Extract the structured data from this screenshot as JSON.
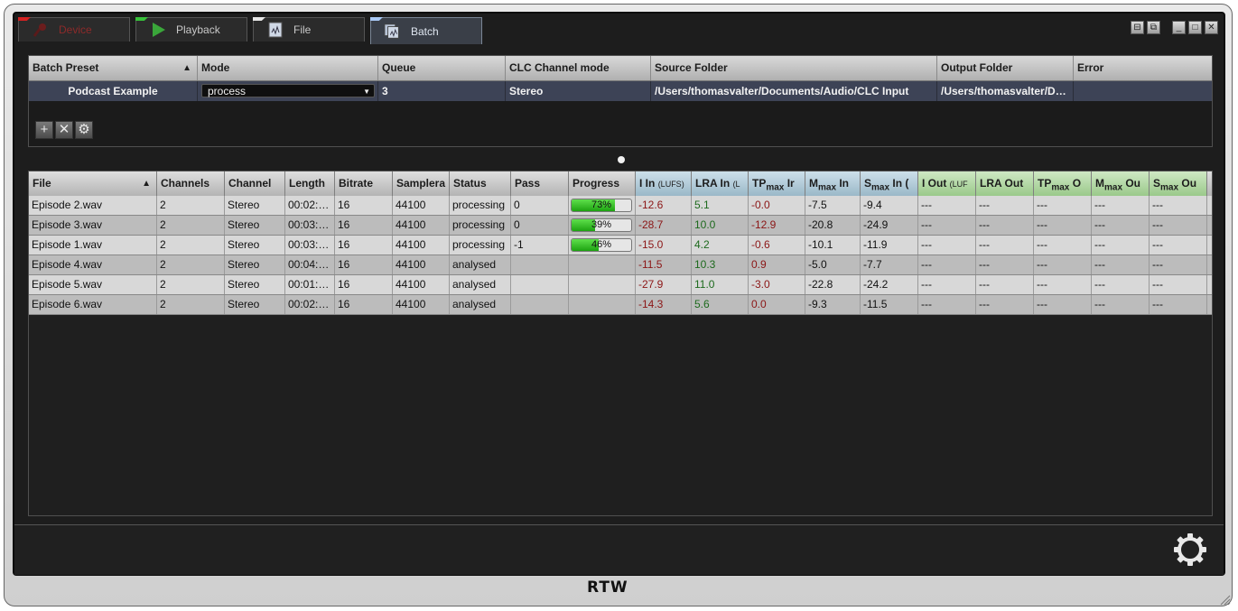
{
  "tabs": [
    {
      "label": "Device",
      "notch": "#d42222"
    },
    {
      "label": "Playback",
      "notch": "#37c23a"
    },
    {
      "label": "File",
      "notch": "#e6e6e6"
    },
    {
      "label": "Batch",
      "notch": "#a9c9f5"
    }
  ],
  "presets": {
    "headers": [
      "Batch Preset",
      "Mode",
      "Queue",
      "CLC Channel mode",
      "Source Folder",
      "Output Folder",
      "Error"
    ],
    "row": {
      "preset": "Podcast Example",
      "mode": "process",
      "queue": "3",
      "clc_mode": "Stereo",
      "source": "/Users/thomasvalter/Documents/Audio/CLC Input",
      "output": "/Users/thomasvalter/D…",
      "error": ""
    }
  },
  "tools": {
    "add": "+",
    "remove": "✕",
    "settings": "⚙"
  },
  "files": {
    "headers": {
      "file": "File",
      "channels": "Channels",
      "channel": "Channel",
      "length": "Length",
      "bitrate": "Bitrate",
      "samplerate": "Samplera",
      "status": "Status",
      "pass": "Pass",
      "progress": "Progress",
      "i_in": "I In",
      "i_in_unit": "(LUFS)",
      "lra_in": "LRA In",
      "lra_in_unit": "(L",
      "tp_in": "TP",
      "tp_in_sub": "max",
      "tp_in_tail": " Ir",
      "m_in": "M",
      "m_in_sub": "max",
      "m_in_tail": " In",
      "s_in": "S",
      "s_in_sub": "max",
      "s_in_tail": " In (",
      "i_out": "I Out",
      "i_out_unit": "(LUF",
      "lra_out": "LRA Out",
      "tp_out": "TP",
      "tp_out_sub": "max",
      "tp_out_tail": " O",
      "m_out": "M",
      "m_out_sub": "max",
      "m_out_tail": " Ou",
      "s_out": "S",
      "s_out_sub": "max",
      "s_out_tail": " Ou"
    },
    "rows": [
      {
        "file": "Episode 2.wav",
        "channels": "2",
        "channel": "Stereo",
        "length": "00:02:…",
        "bitrate": "16",
        "samplerate": "44100",
        "status": "processing",
        "pass": "0",
        "progress": 0.73,
        "progress_label": "73%",
        "i_in": "-12.6",
        "lra_in": "5.1",
        "tp_in": "-0.0",
        "m_in": "-7.5",
        "s_in": "-9.4",
        "i_out": "---",
        "lra_out": "---",
        "tp_out": "---",
        "m_out": "---",
        "s_out": "---"
      },
      {
        "file": "Episode 3.wav",
        "channels": "2",
        "channel": "Stereo",
        "length": "00:03:…",
        "bitrate": "16",
        "samplerate": "44100",
        "status": "processing",
        "pass": "0",
        "progress": 0.39,
        "progress_label": "39%",
        "i_in": "-28.7",
        "lra_in": "10.0",
        "tp_in": "-12.9",
        "m_in": "-20.8",
        "s_in": "-24.9",
        "i_out": "---",
        "lra_out": "---",
        "tp_out": "---",
        "m_out": "---",
        "s_out": "---"
      },
      {
        "file": "Episode 1.wav",
        "channels": "2",
        "channel": "Stereo",
        "length": "00:03:…",
        "bitrate": "16",
        "samplerate": "44100",
        "status": "processing",
        "pass": "-1",
        "progress": 0.46,
        "progress_label": "46%",
        "i_in": "-15.0",
        "lra_in": "4.2",
        "tp_in": "-0.6",
        "m_in": "-10.1",
        "s_in": "-11.9",
        "i_out": "---",
        "lra_out": "---",
        "tp_out": "---",
        "m_out": "---",
        "s_out": "---"
      },
      {
        "file": "Episode 4.wav",
        "channels": "2",
        "channel": "Stereo",
        "length": "00:04:…",
        "bitrate": "16",
        "samplerate": "44100",
        "status": "analysed",
        "pass": "",
        "progress": null,
        "progress_label": "",
        "i_in": "-11.5",
        "lra_in": "10.3",
        "tp_in": "0.9",
        "m_in": "-5.0",
        "s_in": "-7.7",
        "i_out": "---",
        "lra_out": "---",
        "tp_out": "---",
        "m_out": "---",
        "s_out": "---"
      },
      {
        "file": "Episode 5.wav",
        "channels": "2",
        "channel": "Stereo",
        "length": "00:01:…",
        "bitrate": "16",
        "samplerate": "44100",
        "status": "analysed",
        "pass": "",
        "progress": null,
        "progress_label": "",
        "i_in": "-27.9",
        "lra_in": "11.0",
        "tp_in": "-3.0",
        "m_in": "-22.8",
        "s_in": "-24.2",
        "i_out": "---",
        "lra_out": "---",
        "tp_out": "---",
        "m_out": "---",
        "s_out": "---"
      },
      {
        "file": "Episode 6.wav",
        "channels": "2",
        "channel": "Stereo",
        "length": "00:02:…",
        "bitrate": "16",
        "samplerate": "44100",
        "status": "analysed",
        "pass": "",
        "progress": null,
        "progress_label": "",
        "i_in": "-14.3",
        "lra_in": "5.6",
        "tp_in": "0.0",
        "m_in": "-9.3",
        "s_in": "-11.5",
        "i_out": "---",
        "lra_out": "---",
        "tp_out": "---",
        "m_out": "---",
        "s_out": "---"
      }
    ]
  },
  "colors": {
    "loudness_red": "#8b1515",
    "lra_green": "#1d6a1d",
    "row_light": "#d8d8d8",
    "row_dark": "#bcbcbc"
  },
  "brand": "RTW",
  "icons": {
    "settings": "gear-icon",
    "resize": "resize-grip-icon"
  }
}
